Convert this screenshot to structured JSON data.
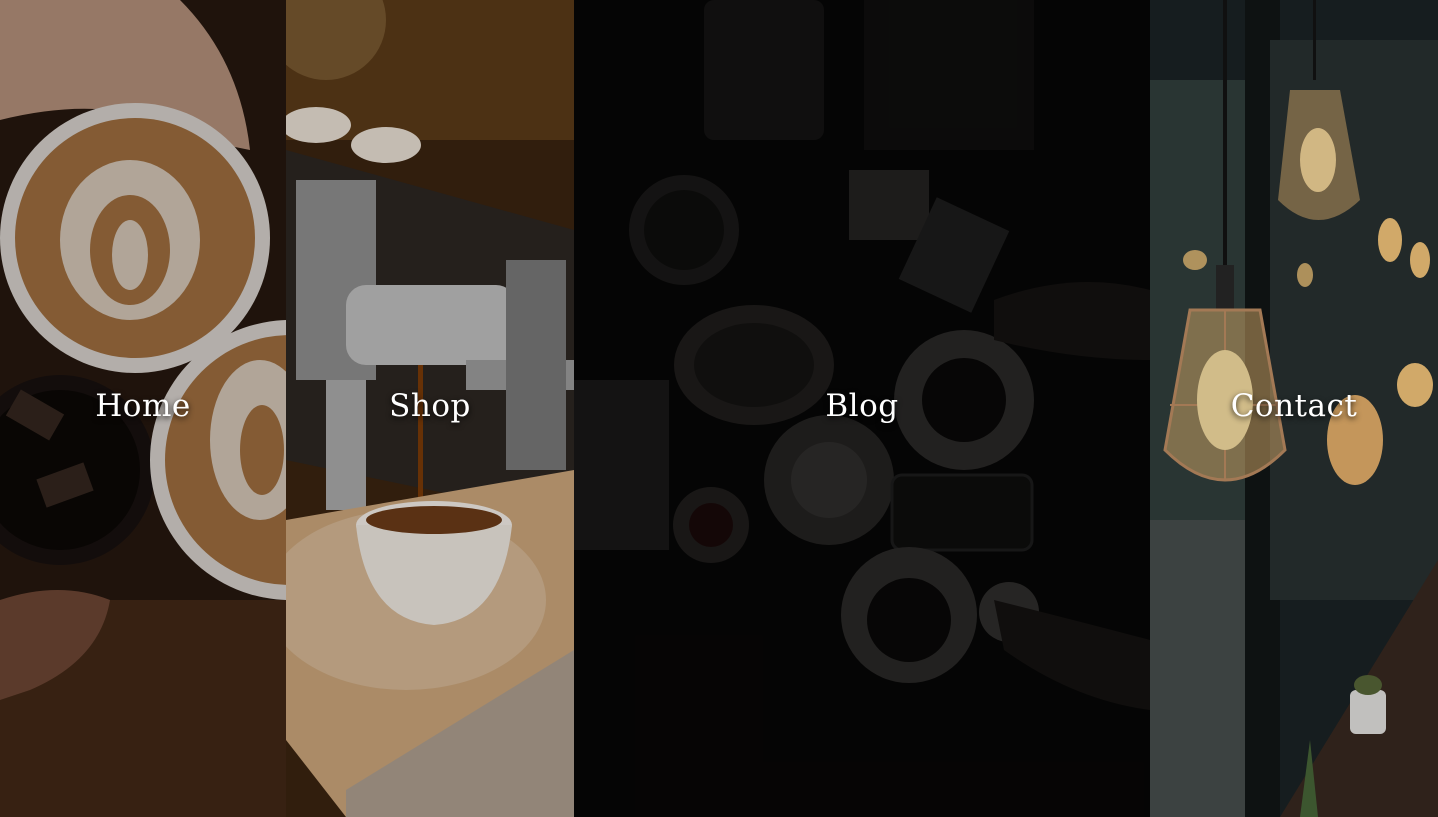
{
  "nav": {
    "items": [
      {
        "label": "Home",
        "shade": "rgba(0,0,0,0.25)"
      },
      {
        "label": "Shop",
        "shade": "rgba(0,0,0,0.15)"
      },
      {
        "label": "Blog",
        "shade": "rgba(0,0,0,0.72)"
      },
      {
        "label": "Contact",
        "shade": "rgba(0,0,0,0.18)"
      }
    ]
  }
}
